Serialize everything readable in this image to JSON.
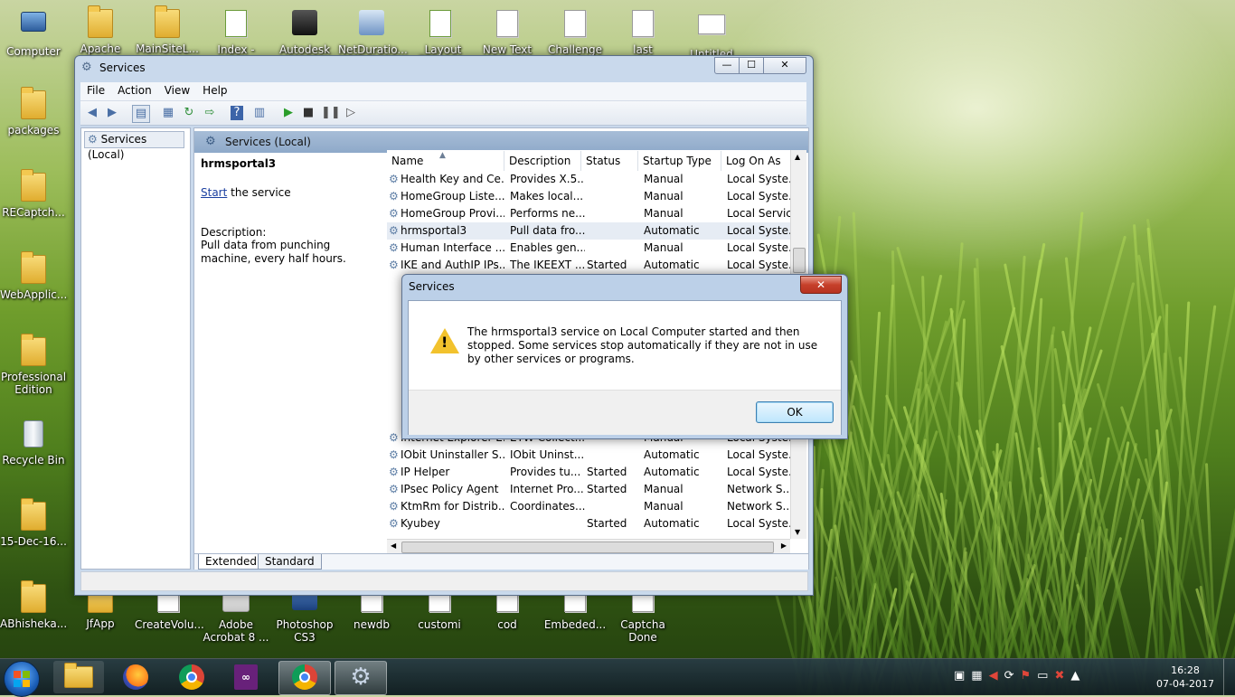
{
  "desktop": {
    "top_icons": [
      "Computer",
      "Apache",
      "MainSiteL...",
      "Index - Copy",
      "Autodesk",
      "NetDuratio...",
      "_Layout",
      "New Text",
      "Challenge",
      "last",
      "Untitled"
    ],
    "left_icons": [
      "packages",
      "RECaptch...",
      "WebApplic...",
      "Professional Edition",
      "Recycle Bin",
      "15-Dec-16...",
      "ABhisheka..."
    ],
    "bottom_icons": [
      "JfApp",
      "CreateVolu...",
      "Adobe Acrobat 8 ...",
      "Photoshop CS3",
      "newdb",
      "customi",
      "cod",
      "Embeded...",
      "Captcha Done"
    ]
  },
  "window": {
    "title": "Services",
    "controls": {
      "minimize": "—",
      "maximize": "☐",
      "close": "✕"
    },
    "menu": [
      "File",
      "Action",
      "View",
      "Help"
    ],
    "tree_root": "Services (Local)",
    "pane_title": "Services (Local)",
    "detail": {
      "service_name": "hrmsportal3",
      "start_link": "Start",
      "start_suffix": " the service",
      "desc_label": "Description:",
      "desc_text": "Pull data from punching machine, every half hours."
    },
    "columns": [
      "Name",
      "Description",
      "Status",
      "Startup Type",
      "Log On As"
    ],
    "rows": [
      [
        "Health Key and Ce...",
        "Provides X.5...",
        "",
        "Manual",
        "Local Syste..."
      ],
      [
        "HomeGroup Liste...",
        "Makes local...",
        "",
        "Manual",
        "Local Syste..."
      ],
      [
        "HomeGroup Provi...",
        "Performs ne...",
        "",
        "Manual",
        "Local Service"
      ],
      [
        "hrmsportal3",
        "Pull data fro...",
        "",
        "Automatic",
        "Local Syste..."
      ],
      [
        "Human Interface ...",
        "Enables gen...",
        "",
        "Manual",
        "Local Syste..."
      ],
      [
        "IKE and AuthIP IPs...",
        "The IKEEXT ...",
        "Started",
        "Automatic",
        "Local Syste..."
      ],
      [
        "Internet Explorer E...",
        "ETW Collect...",
        "",
        "Manual",
        "Local Syste..."
      ],
      [
        "IObit Uninstaller S...",
        "IObit Uninst...",
        "",
        "Automatic",
        "Local Syste..."
      ],
      [
        "IP Helper",
        "Provides tu...",
        "Started",
        "Automatic",
        "Local Syste..."
      ],
      [
        "IPsec Policy Agent",
        "Internet Pro...",
        "Started",
        "Manual",
        "Network S..."
      ],
      [
        "KtmRm for Distrib...",
        "Coordinates...",
        "",
        "Manual",
        "Network S..."
      ],
      [
        "Kyubey",
        "",
        "Started",
        "Automatic",
        "Local Syste..."
      ]
    ],
    "tabs": [
      "Extended",
      "Standard"
    ]
  },
  "dialog": {
    "title": "Services",
    "close": "✕",
    "message": "The hrmsportal3 service on Local Computer started and then stopped. Some services stop automatically if they are not in use by other services or programs.",
    "ok_label": "OK"
  },
  "taskbar": {
    "time": "16:28",
    "date": "07-04-2017"
  }
}
